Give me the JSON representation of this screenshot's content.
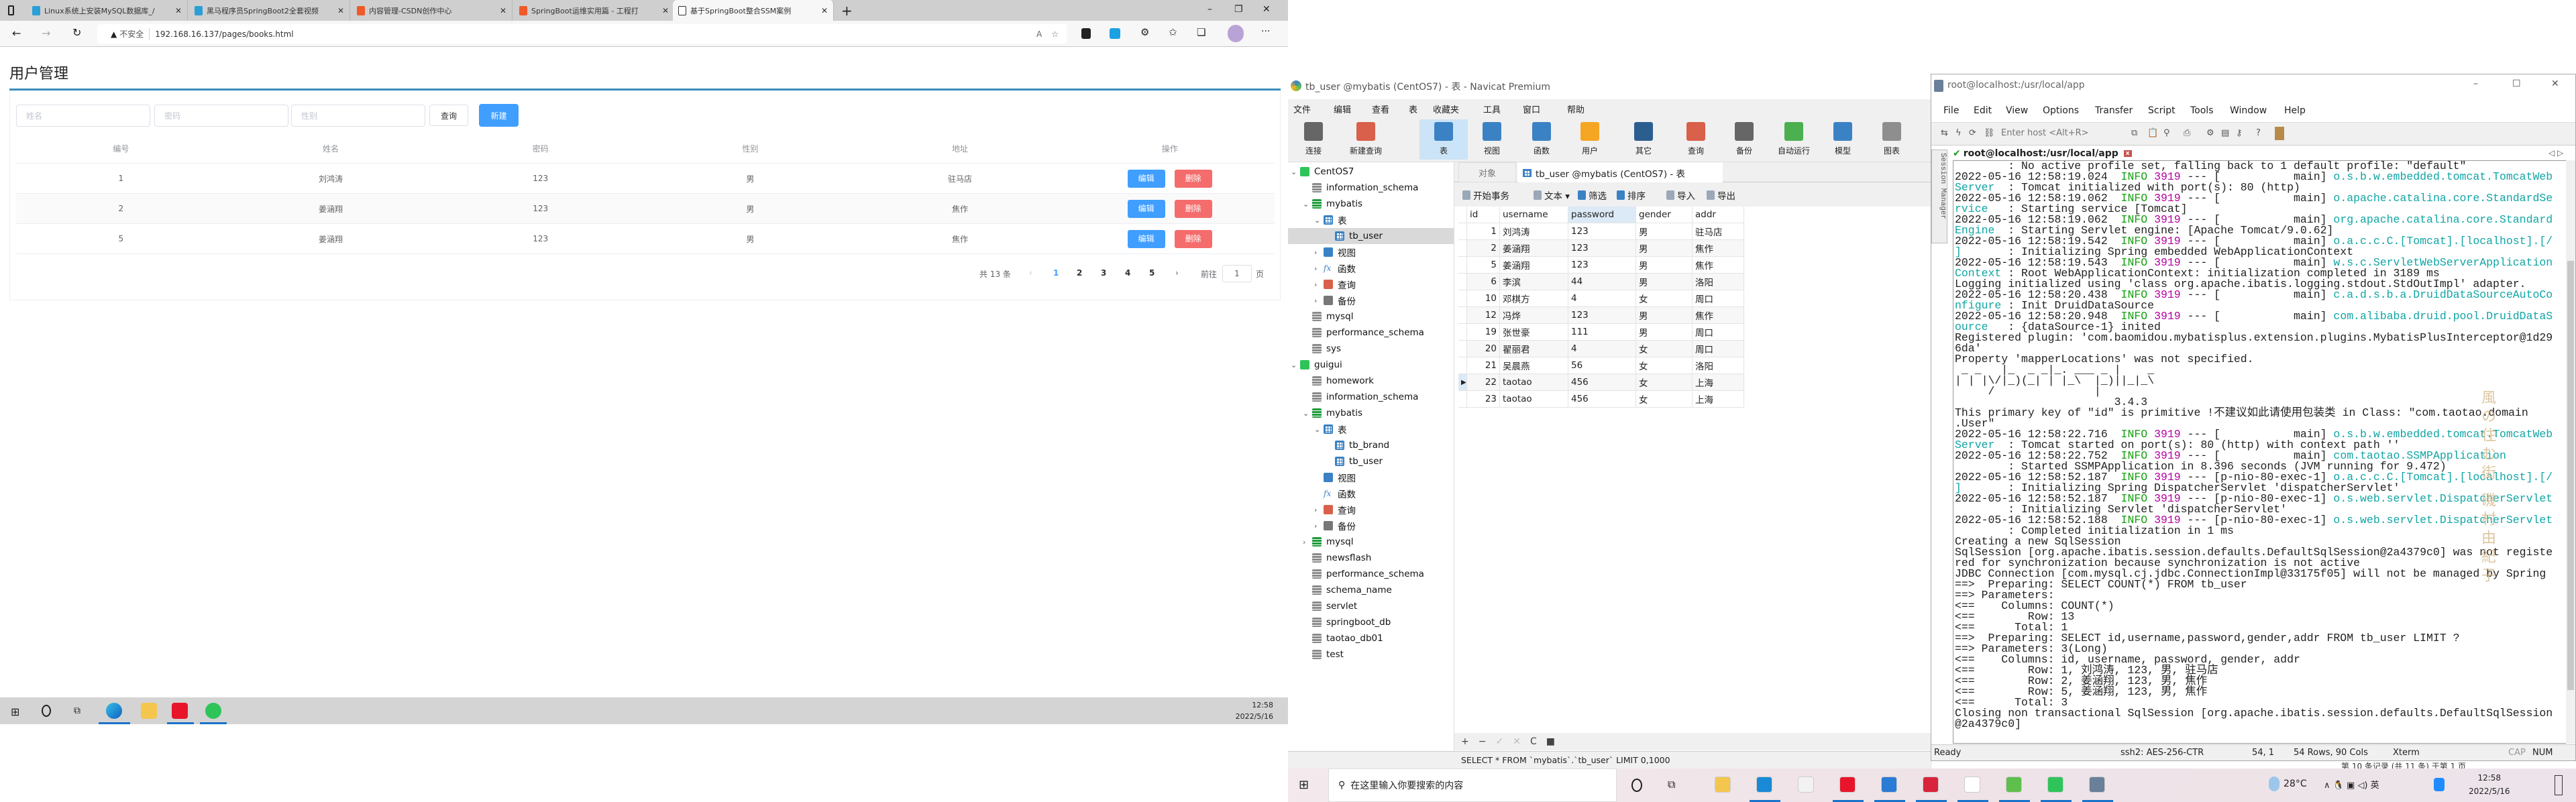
{
  "browser": {
    "tabs": [
      {
        "label": "Linux系统上安装MySQL数据库_/",
        "color": "#2a9fd6"
      },
      {
        "label": "黑马程序员SpringBoot2全套视频",
        "color": "#2a9fd6"
      },
      {
        "label": "内容管理-CSDN创作中心",
        "color": "#f05a28"
      },
      {
        "label": "SpringBoot运维实用篇 - 工程打",
        "color": "#f05a28"
      },
      {
        "label": "基于SpringBoot整合SSM案例",
        "color": "#ffffff",
        "active": true
      }
    ],
    "new_tab": "+",
    "security": "不安全",
    "url": "192.168.16.137/pages/books.html"
  },
  "page": {
    "title": "用户管理",
    "filters": {
      "name_placeholder": "姓名",
      "password_placeholder": "密码",
      "gender_placeholder": "性别",
      "query": "查询",
      "create": "新建"
    },
    "columns": [
      "编号",
      "姓名",
      "密码",
      "性别",
      "地址",
      "操作"
    ],
    "rows": [
      [
        "1",
        "刘鸿涛",
        "123",
        "男",
        "驻马店"
      ],
      [
        "2",
        "姜涵翔",
        "123",
        "男",
        "焦作"
      ],
      [
        "5",
        "姜涵翔",
        "123",
        "男",
        "焦作"
      ]
    ],
    "edit": "编辑",
    "delete": "删除",
    "pagination": {
      "total": "共 13 条",
      "prev": "‹",
      "pages": [
        "1",
        "2",
        "3",
        "4",
        "5"
      ],
      "current": "1",
      "next": "›",
      "goto": "前往",
      "goto_value": "1",
      "page_unit": "页"
    },
    "colors": {
      "primary": "#409eff",
      "danger": "#f56c6c"
    }
  },
  "left_taskbar": {
    "time": "12:58",
    "date": "2022/5/16"
  },
  "navicat": {
    "title": "tb_user @mybatis (CentOS7) - 表 - Navicat Premium",
    "menu": [
      "文件",
      "编辑",
      "查看",
      "表",
      "收藏夹",
      "工具",
      "窗口",
      "帮助"
    ],
    "toolbar": [
      {
        "label": "连接",
        "icon": "plug-icon"
      },
      {
        "label": "新建查询",
        "icon": "new-query-icon"
      },
      {
        "label": "表",
        "icon": "table-icon",
        "selected": true
      },
      {
        "label": "视图",
        "icon": "view-icon"
      },
      {
        "label": "函数",
        "icon": "function-icon"
      },
      {
        "label": "用户",
        "icon": "user-icon"
      },
      {
        "label": "其它",
        "icon": "tools-icon"
      },
      {
        "label": "查询",
        "icon": "query-icon"
      },
      {
        "label": "备份",
        "icon": "backup-icon"
      },
      {
        "label": "自动运行",
        "icon": "schedule-icon"
      },
      {
        "label": "模型",
        "icon": "model-icon"
      },
      {
        "label": "图表",
        "icon": "chart-icon"
      }
    ],
    "tree": [
      {
        "label": "CentOS7",
        "level": 0,
        "type": "conn",
        "chev": "⌄"
      },
      {
        "label": "information_schema",
        "level": 1,
        "type": "db"
      },
      {
        "label": "mybatis",
        "level": 1,
        "type": "dbo",
        "chev": "⌄"
      },
      {
        "label": "表",
        "level": 2,
        "type": "tbl",
        "chev": "⌄"
      },
      {
        "label": "tb_user",
        "level": 3,
        "type": "tbl",
        "selected": true
      },
      {
        "label": "视图",
        "level": 2,
        "type": "view",
        "chev": "›"
      },
      {
        "label": "函数",
        "level": 2,
        "type": "fx",
        "chev": "›"
      },
      {
        "label": "查询",
        "level": 2,
        "type": "query",
        "chev": "›"
      },
      {
        "label": "备份",
        "level": 2,
        "type": "backup",
        "chev": "›"
      },
      {
        "label": "mysql",
        "level": 1,
        "type": "db"
      },
      {
        "label": "performance_schema",
        "level": 1,
        "type": "db"
      },
      {
        "label": "sys",
        "level": 1,
        "type": "db"
      },
      {
        "label": "guigui",
        "level": 0,
        "type": "conn",
        "chev": "⌄"
      },
      {
        "label": "homework",
        "level": 1,
        "type": "db"
      },
      {
        "label": "information_schema",
        "level": 1,
        "type": "db"
      },
      {
        "label": "mybatis",
        "level": 1,
        "type": "dbo",
        "chev": "⌄"
      },
      {
        "label": "表",
        "level": 2,
        "type": "tbl",
        "chev": "⌄"
      },
      {
        "label": "tb_brand",
        "level": 3,
        "type": "tbl"
      },
      {
        "label": "tb_user",
        "level": 3,
        "type": "tbl"
      },
      {
        "label": "视图",
        "level": 2,
        "type": "view"
      },
      {
        "label": "函数",
        "level": 2,
        "type": "fx"
      },
      {
        "label": "查询",
        "level": 2,
        "type": "query",
        "chev": "›"
      },
      {
        "label": "备份",
        "level": 2,
        "type": "backup",
        "chev": "›"
      },
      {
        "label": "mysql",
        "level": 1,
        "type": "dbo",
        "chev": "›"
      },
      {
        "label": "newsflash",
        "level": 1,
        "type": "db"
      },
      {
        "label": "performance_schema",
        "level": 1,
        "type": "db"
      },
      {
        "label": "schema_name",
        "level": 1,
        "type": "db"
      },
      {
        "label": "servlet",
        "level": 1,
        "type": "db"
      },
      {
        "label": "springboot_db",
        "level": 1,
        "type": "db"
      },
      {
        "label": "taotao_db01",
        "level": 1,
        "type": "db"
      },
      {
        "label": "test",
        "level": 1,
        "type": "db"
      }
    ],
    "objects_tab": "对象",
    "table_tab": "tb_user @mybatis (CentOS7) - 表",
    "grid_toolbar": [
      "开始事务",
      "文本",
      "筛选",
      "排序",
      "导入",
      "导出"
    ],
    "grid_columns": [
      "id",
      "username",
      "password",
      "gender",
      "addr"
    ],
    "grid_rows": [
      [
        "1",
        "刘鸿涛",
        "123",
        "男",
        "驻马店"
      ],
      [
        "2",
        "姜涵翔",
        "123",
        "男",
        "焦作"
      ],
      [
        "5",
        "姜涵翔",
        "123",
        "男",
        "焦作"
      ],
      [
        "6",
        "李滨",
        "44",
        "男",
        "洛阳"
      ],
      [
        "10",
        "邓棋方",
        "4",
        "女",
        "周口"
      ],
      [
        "12",
        "冯烨",
        "123",
        "男",
        "焦作"
      ],
      [
        "19",
        "张世豪",
        "111",
        "男",
        "周口"
      ],
      [
        "20",
        "翟丽君",
        "4",
        "女",
        "周口"
      ],
      [
        "21",
        "吴晨燕",
        "56",
        "女",
        "洛阳"
      ],
      [
        "22",
        "taotao",
        "456",
        "女",
        "上海"
      ],
      [
        "23",
        "taotao",
        "456",
        "女",
        "上海"
      ]
    ],
    "current_row": "22",
    "bottom_buttons": [
      "+",
      "−",
      "✓",
      "✕",
      "C",
      "■"
    ],
    "sql": "SELECT * FROM `mybatis`.`tb_user` LIMIT 0,1000",
    "record_status": "第 10 条记录 (共 11 条) 于第 1 页"
  },
  "terminal": {
    "title": "root@localhost:/usr/local/app",
    "menu": [
      "File",
      "Edit",
      "View",
      "Options",
      "Transfer",
      "Script",
      "Tools",
      "Window",
      "Help"
    ],
    "host_placeholder": "Enter host <Alt+R>",
    "tab": "root@localhost:/usr/local/app",
    "session_manager": "Session Manager",
    "watermark": "風の住む街 磯村由紀子",
    "lines": [
      "        : No active profile set, falling back to 1 default profile: \"default\"",
      "2022-05-16 12:58:19.024  INFO 3919 --- [           main] o.s.b.w.embedded.tomcat.TomcatWeb",
      [
        "Server",
        "  : Tomcat initialized with port(s): 80 (http)"
      ],
      "2022-05-16 12:58:19.062  INFO 3919 --- [           main] o.apache.catalina.core.StandardSe",
      [
        "rvice",
        "   : Starting service [Tomcat]"
      ],
      "2022-05-16 12:58:19.062  INFO 3919 --- [           main] org.apache.catalina.core.Standard",
      [
        "Engine",
        "  : Starting Servlet engine: [Apache Tomcat/9.0.62]"
      ],
      "2022-05-16 12:58:19.542  INFO 3919 --- [           main] o.a.c.c.C.[Tomcat].[localhost].[/",
      [
        "]",
        "       : Initializing Spring embedded WebApplicationContext"
      ],
      "2022-05-16 12:58:19.543  INFO 3919 --- [           main] w.s.c.ServletWebServerApplication",
      [
        "Context",
        " : Root WebApplicationContext: initialization completed in 3189 ms"
      ],
      "Logging initialized using 'class org.apache.ibatis.logging.stdout.StdOutImpl' adapter.",
      "2022-05-16 12:58:20.438  INFO 3919 --- [           main] c.a.d.s.b.a.DruidDataSourceAutoCo",
      [
        "nfigure",
        " : Init DruidDataSource"
      ],
      "2022-05-16 12:58:20.948  INFO 3919 --- [           main] com.alibaba.druid.pool.DruidDataS",
      [
        "ource",
        "   : {dataSource-1} inited"
      ],
      "Registered plugin: 'com.baomidou.mybatisplus.extension.plugins.MybatisPlusInterceptor@1d29",
      "6da'",
      "Property 'mapperLocations' was not specified.",
      " _ _   |_  _ _|_. ___ _ |    _ ",
      "| | |\\/|_)(_| | |_\\  |_)||_|_\\ ",
      "     /               |         ",
      "                        3.4.3 ",
      "This primary key of \"id\" is primitive !不建议如此请使用包装类 in Class: \"com.taotao.domain",
      ".User\"",
      "2022-05-16 12:58:22.716  INFO 3919 --- [           main] o.s.b.w.embedded.tomcat.TomcatWeb",
      [
        "Server",
        "  : Tomcat started on port(s): 80 (http) with context path ''"
      ],
      "2022-05-16 12:58:22.752  INFO 3919 --- [           main] com.taotao.SSMPApplication",
      [
        "",
        "        : Started SSMPApplication in 8.396 seconds (JVM running for 9.472)"
      ],
      "2022-05-16 12:58:52.187  INFO 3919 --- [p-nio-80-exec-1] o.a.c.c.C.[Tomcat].[localhost].[/",
      [
        "]",
        "       : Initializing Spring DispatcherServlet 'dispatcherServlet'"
      ],
      "2022-05-16 12:58:52.187  INFO 3919 --- [p-nio-80-exec-1] o.s.web.servlet.DispatcherServlet",
      [
        "",
        "        : Initializing Servlet 'dispatcherServlet'"
      ],
      "2022-05-16 12:58:52.188  INFO 3919 --- [p-nio-80-exec-1] o.s.web.servlet.DispatcherServlet",
      [
        "",
        "        : Completed initialization in 1 ms"
      ],
      "Creating a new SqlSession",
      "SqlSession [org.apache.ibatis.session.defaults.DefaultSqlSession@2a4379c0] was not registe",
      "red for synchronization because synchronization is not active",
      "JDBC Connection [com.mysql.cj.jdbc.ConnectionImpl@33175f05] will not be managed by Spring",
      "==>  Preparing: SELECT COUNT(*) FROM tb_user",
      "==> Parameters: ",
      "<==    Columns: COUNT(*)",
      "<==        Row: 13",
      "<==      Total: 1",
      "==>  Preparing: SELECT id,username,password,gender,addr FROM tb_user LIMIT ?",
      "==> Parameters: 3(Long)",
      "<==    Columns: id, username, password, gender, addr",
      "<==        Row: 1, 刘鸿涛, 123, 男, 驻马店",
      "<==        Row: 2, 姜涵翔, 123, 男, 焦作",
      "<==        Row: 5, 姜涵翔, 123, 男, 焦作",
      "<==      Total: 3",
      "Closing non transactional SqlSession [org.apache.ibatis.session.defaults.DefaultSqlSession",
      "@2a4379c0]"
    ],
    "status": {
      "ready": "Ready",
      "cipher": "ssh2: AES-256-CTR",
      "cursor": "54,  1",
      "size": "54 Rows, 90 Cols",
      "term": "Xterm",
      "cap": "CAP",
      "num": "NUM"
    }
  },
  "right_taskbar": {
    "search_placeholder": "在这里输入你要搜索的内容",
    "weather": "28°C",
    "time": "12:58",
    "date": "2022/5/16"
  }
}
